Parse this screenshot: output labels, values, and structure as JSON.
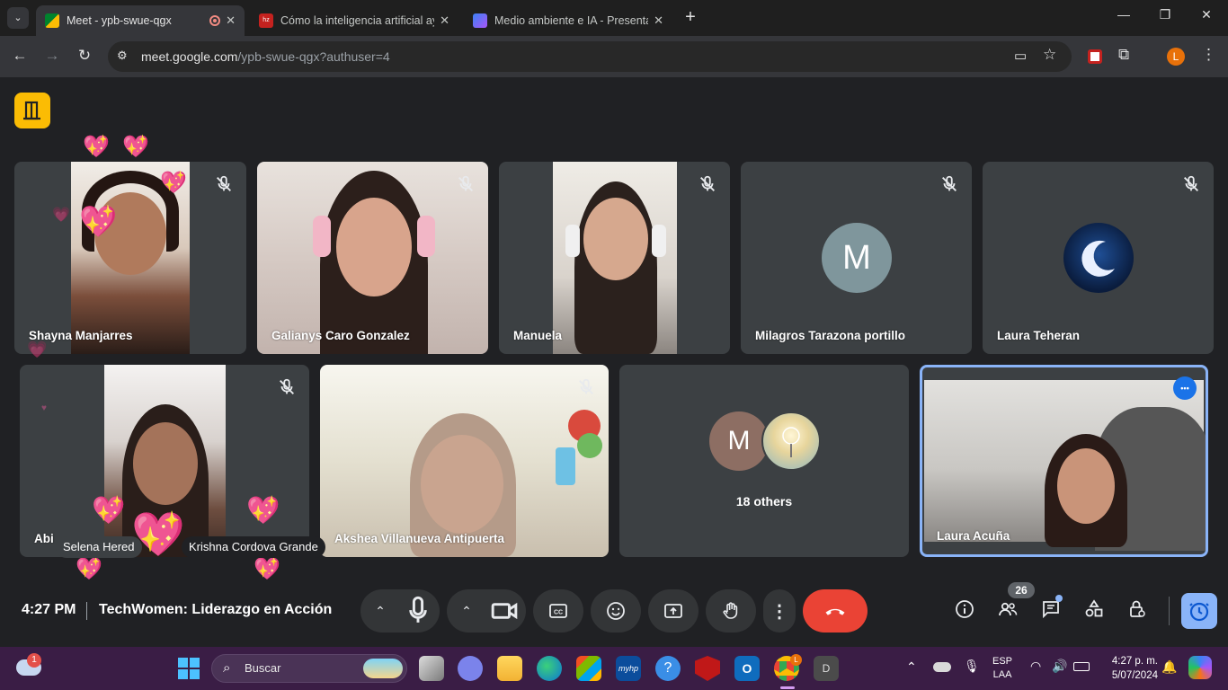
{
  "browser": {
    "tabs": [
      {
        "title": "Meet - ypb-swue-qgx",
        "active": true
      },
      {
        "title": "Cómo la inteligencia artificial ay",
        "active": false
      },
      {
        "title": "Medio ambiente e IA - Presenta",
        "active": false
      }
    ],
    "new_tab": "+",
    "url_host": "meet.google.com",
    "url_path": "/ypb-swue-qgx?authuser=4",
    "profile_initial": "L"
  },
  "tiles": [
    {
      "name": "Shayna Manjarres"
    },
    {
      "name": "Galianys Caro Gonzalez"
    },
    {
      "name": "Manuela"
    },
    {
      "name": "Milagros Tarazona portillo",
      "avatar": "M"
    },
    {
      "name": "Laura Teheran"
    },
    {
      "name": "Abi"
    },
    {
      "name": "Akshea Villanueva Antipuerta"
    },
    {
      "label": "18 others",
      "avatar": "M"
    },
    {
      "name": "Laura Acuña"
    }
  ],
  "reaction_labels": [
    "Selena Hered",
    "Krishna Cordova Grande"
  ],
  "meeting": {
    "time": "4:27 PM",
    "title": "TechWomen: Liderazgo en Acción",
    "participant_count": "26",
    "more_dots": "•••"
  },
  "taskbar": {
    "search_placeholder": "Buscar",
    "lang_line1": "ESP",
    "lang_line2": "LAA",
    "clock_time": "4:27 p. m.",
    "clock_date": "5/07/2024",
    "weather_badge": "1",
    "chrome_badge": "L",
    "app_d": "D"
  },
  "colors": {
    "meet_yellow": "#fbbc04",
    "end_call_red": "#ea4335",
    "active_border": "#8ab4f8",
    "tile_bg": "#3c4043"
  }
}
